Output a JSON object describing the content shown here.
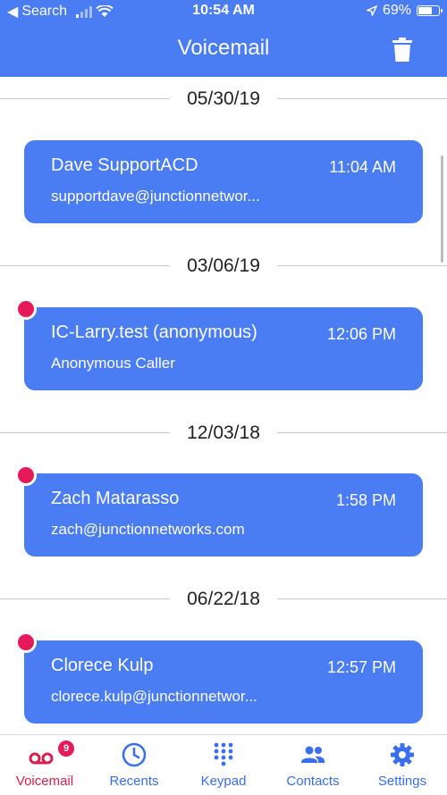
{
  "status_bar": {
    "carrier_back": "Search",
    "time": "10:54 AM",
    "battery": "69%"
  },
  "header": {
    "title": "Voicemail"
  },
  "groups": [
    {
      "date": "05/30/19",
      "name": "Dave SupportACD",
      "time": "11:04 AM",
      "sub": "supportdave@junctionnetwor...",
      "unread": false
    },
    {
      "date": "03/06/19",
      "name": "IC-Larry.test (anonymous)",
      "time": "12:06 PM",
      "sub": "Anonymous Caller",
      "unread": true
    },
    {
      "date": "12/03/18",
      "name": "Zach Matarasso",
      "time": "1:58 PM",
      "sub": "zach@junctionnetworks.com",
      "unread": true
    },
    {
      "date": "06/22/18",
      "name": "Clorece Kulp",
      "time": "12:57 PM",
      "sub": "clorece.kulp@junctionnetwor...",
      "unread": true
    }
  ],
  "tabbar": {
    "badge": "9",
    "tabs": [
      {
        "label": "Voicemail",
        "icon": "voicemail-icon",
        "active": true
      },
      {
        "label": "Recents",
        "icon": "clock-icon"
      },
      {
        "label": "Keypad",
        "icon": "keypad-icon"
      },
      {
        "label": "Contacts",
        "icon": "contacts-icon"
      },
      {
        "label": "Settings",
        "icon": "gear-icon"
      }
    ]
  },
  "colors": {
    "primary": "#4a7cf4",
    "unread": "#e6195a",
    "active_tab": "#d6214e"
  }
}
